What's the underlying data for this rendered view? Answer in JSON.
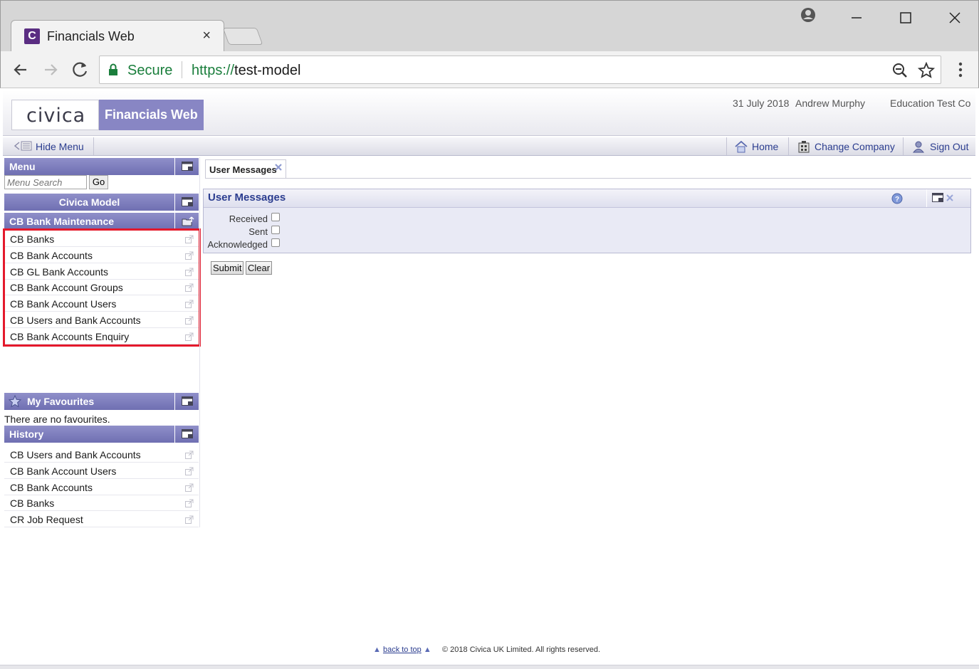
{
  "browser": {
    "tab_title": "Financials Web",
    "tab_close": "×",
    "favicon_letter": "C",
    "secure_label": "Secure",
    "url_scheme": "https://",
    "url_host": "test-model"
  },
  "header": {
    "logo": "civica",
    "product": "Financials Web",
    "date": "31 July 2018",
    "user": "Andrew Murphy",
    "company": "Education Test Co"
  },
  "menubar": {
    "hide_menu": "Hide Menu",
    "home": "Home",
    "change_company": "Change Company",
    "sign_out": "Sign Out"
  },
  "sidebar": {
    "menu_title": "Menu",
    "search_placeholder": "Menu Search",
    "go_label": "Go",
    "model_title": "Civica Model",
    "section_title": "CB Bank Maintenance",
    "items": [
      {
        "label": "CB Banks"
      },
      {
        "label": "CB Bank Accounts"
      },
      {
        "label": "CB GL Bank Accounts"
      },
      {
        "label": "CB Bank Account Groups"
      },
      {
        "label": "CB Bank Account Users"
      },
      {
        "label": "CB Users and Bank Accounts"
      },
      {
        "label": "CB Bank Accounts Enquiry"
      }
    ],
    "favourites_title": "My Favourites",
    "no_favourites": "There are no favourites.",
    "history_title": "History",
    "history": [
      {
        "label": "CB Users and Bank Accounts"
      },
      {
        "label": "CB Bank Account Users"
      },
      {
        "label": "CB Bank Accounts"
      },
      {
        "label": "CB Banks"
      },
      {
        "label": "CR Job Request"
      }
    ]
  },
  "main": {
    "tab_label": "User Messages",
    "panel_title": "User Messages",
    "fields": [
      {
        "label": "Received",
        "checked": false
      },
      {
        "label": "Sent",
        "checked": false
      },
      {
        "label": "Acknowledged",
        "checked": false
      }
    ],
    "submit_label": "Submit",
    "clear_label": "Clear"
  },
  "footer": {
    "back_to_top": "back to top",
    "copyright": "© 2018 Civica UK Limited. All rights reserved."
  },
  "colors": {
    "panel_header": "#7e7ebd",
    "link": "#2b3d8f",
    "highlight": "#e4192b",
    "secure_green": "#1a7e3c"
  }
}
